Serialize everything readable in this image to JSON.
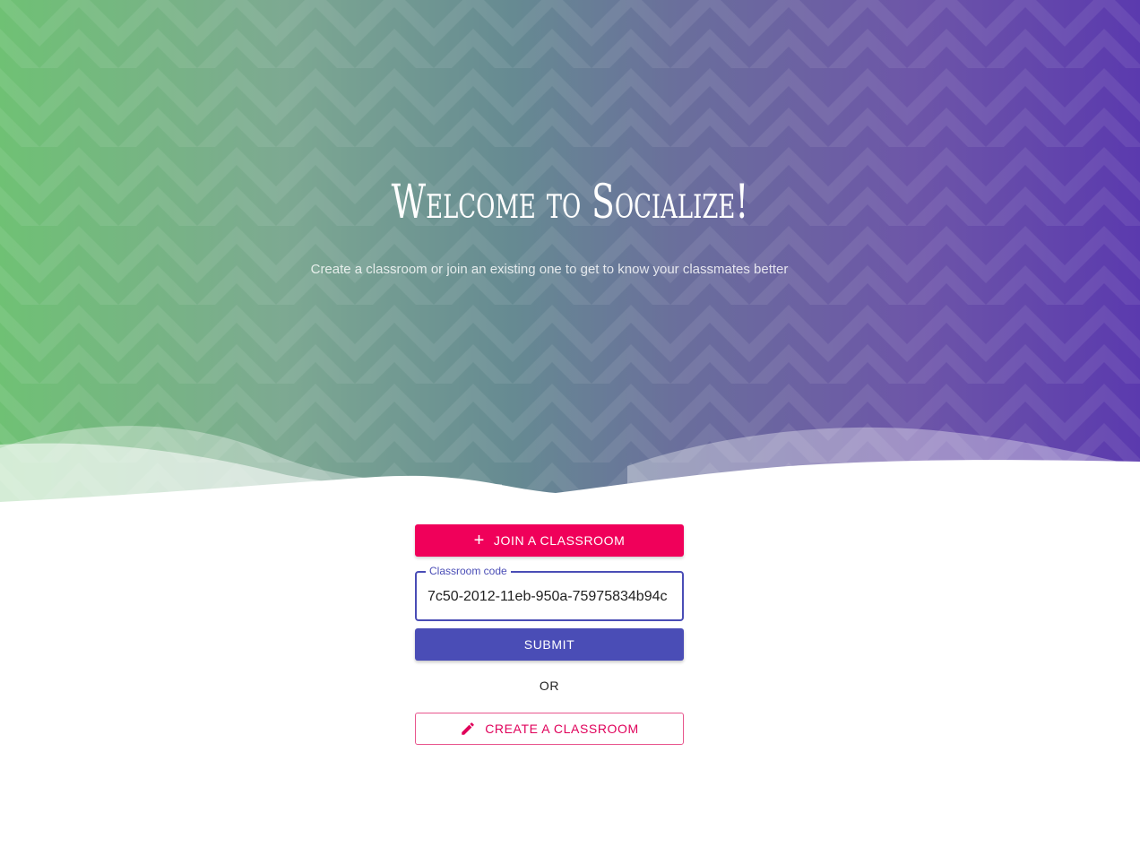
{
  "hero": {
    "title": "Welcome to Socialize!",
    "subtitle": "Create a classroom or join an existing one to get to know your classmates better"
  },
  "join": {
    "label": "Join a classroom",
    "icon": "plus-icon"
  },
  "classroom_code": {
    "label": "Classroom code",
    "value": "7c50-2012-11eb-950a-75975834b94c"
  },
  "submit": {
    "label": "Submit"
  },
  "divider": {
    "text": "OR"
  },
  "create": {
    "label": "Create a classroom",
    "icon": "pencil-icon"
  },
  "colors": {
    "primary_pink": "#f0005a",
    "primary_indigo": "#4a4db6",
    "gradient_left": "#6fc174",
    "gradient_right": "#5b3aae"
  }
}
